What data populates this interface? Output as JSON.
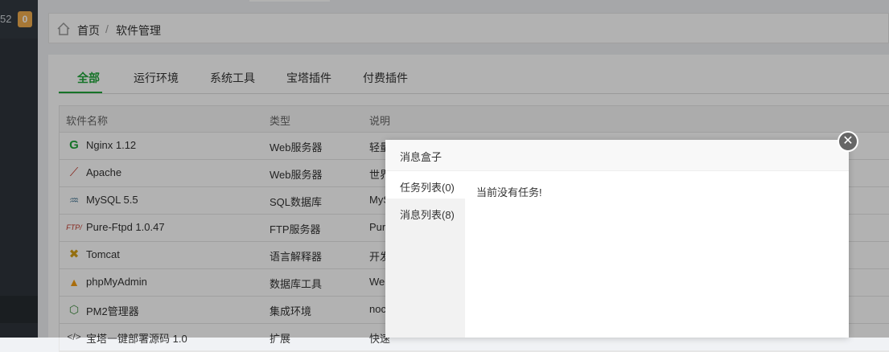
{
  "sidebar": {
    "number": "52",
    "badge": "0"
  },
  "breadcrumb": {
    "home": "首页",
    "separator": "/",
    "current": "软件管理"
  },
  "tabs": [
    {
      "label": "全部",
      "active": true
    },
    {
      "label": "运行环境"
    },
    {
      "label": "系统工具"
    },
    {
      "label": "宝塔插件"
    },
    {
      "label": "付费插件"
    }
  ],
  "table": {
    "headers": {
      "name": "软件名称",
      "type": "类型",
      "desc": "说明"
    },
    "rows": [
      {
        "icon": "nginx-icon",
        "name": "Nginx 1.12",
        "type": "Web服务器",
        "desc": "轻量"
      },
      {
        "icon": "apache-icon",
        "name": "Apache",
        "type": "Web服务器",
        "desc": "世界"
      },
      {
        "icon": "mysql-icon",
        "name": "MySQL 5.5",
        "type": "SQL数据库",
        "desc": "MyS"
      },
      {
        "icon": "ftp-icon",
        "name": "Pure-Ftpd 1.0.47",
        "type": "FTP服务器",
        "desc": "Pur"
      },
      {
        "icon": "tomcat-icon",
        "name": "Tomcat",
        "type": "语言解释器",
        "desc": "开发"
      },
      {
        "icon": "phpmyadmin-icon",
        "name": "phpMyAdmin",
        "type": "数据库工具",
        "desc": "We"
      },
      {
        "icon": "pm2-icon",
        "name": "PM2管理器",
        "type": "集成环境",
        "desc": "noc"
      },
      {
        "icon": "code-icon",
        "name": "宝塔一键部署源码 1.0",
        "type": "扩展",
        "desc": "快速"
      }
    ]
  },
  "modal": {
    "title": "消息盒子",
    "tabs": [
      {
        "label": "任务列表(0)",
        "active": true
      },
      {
        "label": "消息列表(8)"
      }
    ],
    "content": "当前没有任务!",
    "close": "✕"
  }
}
